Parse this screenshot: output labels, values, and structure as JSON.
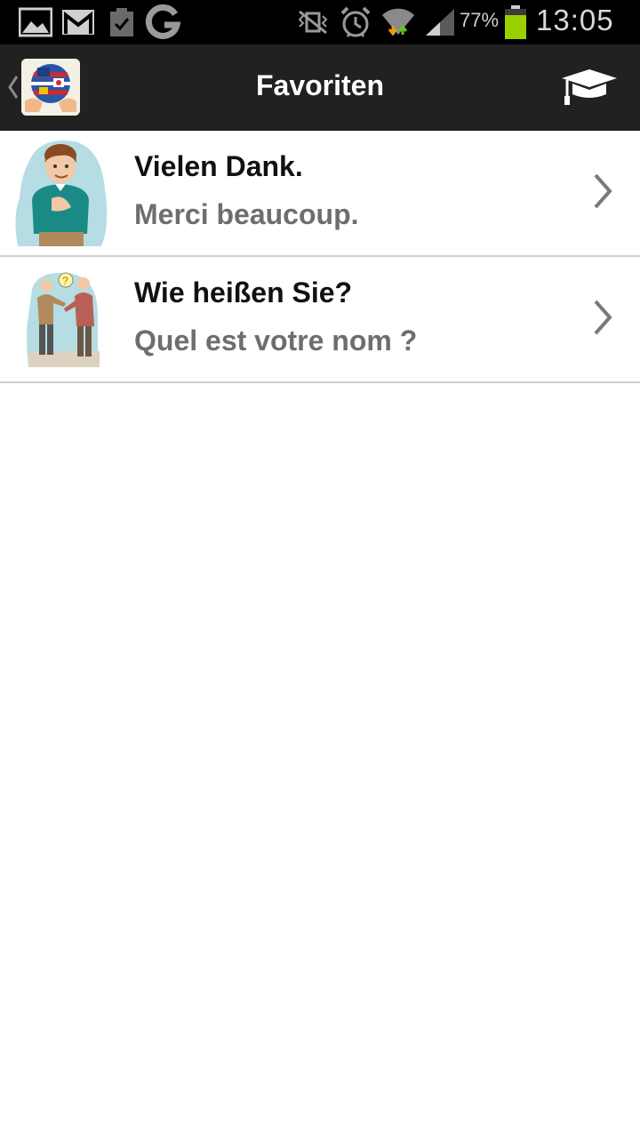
{
  "statusbar": {
    "icons_left": [
      "gallery-icon",
      "gmail-icon",
      "clipboard-check-icon",
      "google-icon"
    ],
    "icons_right": [
      "vibrate-icon",
      "alarm-icon",
      "wifi-icon",
      "signal-icon",
      "battery-icon"
    ],
    "battery_pct": "77%",
    "time": "13:05",
    "battery_color": "#9bd000"
  },
  "actionbar": {
    "title": "Favoriten",
    "background": "#212121"
  },
  "favorites": [
    {
      "primary": "Vielen Dank.",
      "secondary": "Merci beaucoup."
    },
    {
      "primary": "Wie heißen Sie?",
      "secondary": "Quel est votre nom ?"
    }
  ]
}
